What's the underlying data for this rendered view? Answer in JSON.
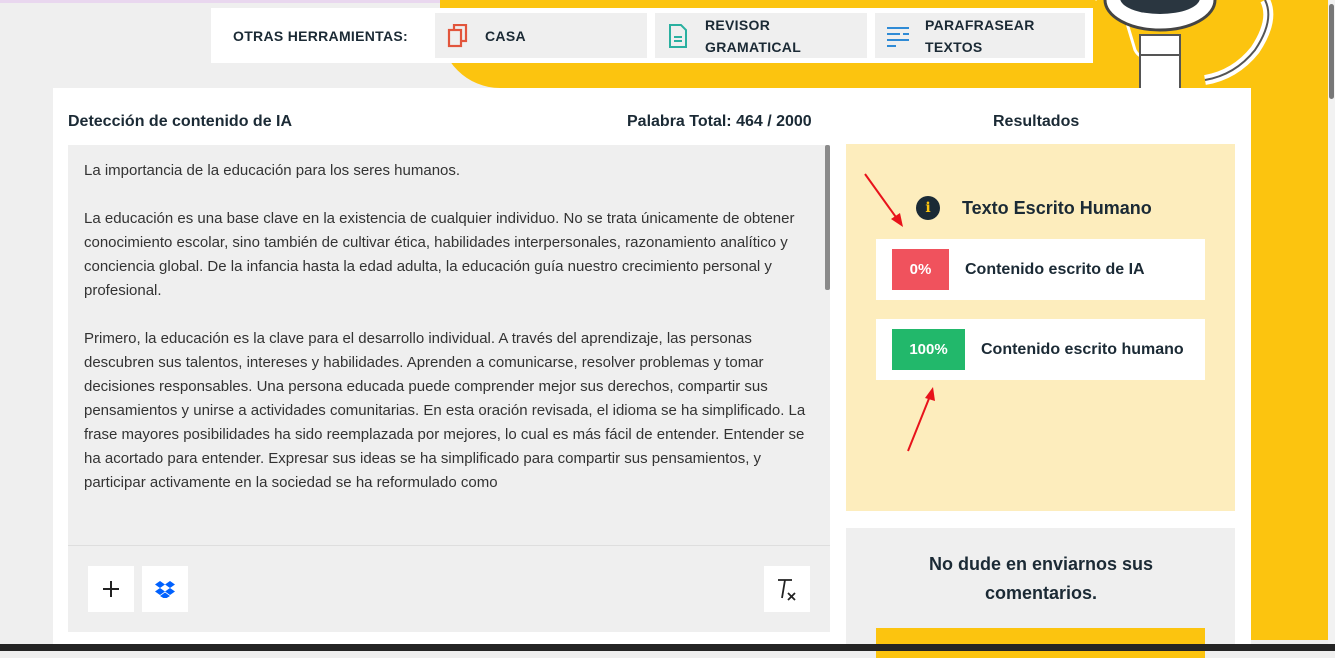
{
  "tools_bar": {
    "label": "OTRAS HERRAMIENTAS:",
    "items": [
      {
        "label": "CASA",
        "icon": "copy-icon",
        "color": "#e2553c"
      },
      {
        "label": "REVISOR GRAMATICAL",
        "icon": "document-icon",
        "color": "#2ab0a0"
      },
      {
        "label": "PARAFRASEAR TEXTOS",
        "icon": "paraphrase-icon",
        "color": "#2f8bd6"
      }
    ]
  },
  "detector": {
    "title": "Detección de contenido de IA",
    "word_count": "Palabra Total: 464 / 2000",
    "paragraphs": [
      "La importancia de la educación para los seres humanos.",
      "La educación es una base clave en la existencia de cualquier individuo. No se trata únicamente de obtener conocimiento escolar, sino también de cultivar ética, habilidades interpersonales, razonamiento analítico y conciencia global. De la infancia hasta la edad adulta, la educación guía nuestro crecimiento personal y profesional.",
      "Primero, la educación es la clave para el desarrollo individual. A través del aprendizaje, las personas descubren sus talentos, intereses y habilidades. Aprenden a comunicarse, resolver problemas y tomar decisiones responsables. Una persona educada puede comprender mejor sus derechos, compartir sus pensamientos y unirse a actividades comunitarias. En esta oración revisada, el idioma se ha simplificado. La frase mayores posibilidades ha sido reemplazada por mejores, lo cual es más fácil de entender. Entender se ha acortado para entender. Expresar sus ideas se ha simplificado para compartir sus pensamientos, y participar activamente en la sociedad se ha reformulado como"
    ]
  },
  "results": {
    "title": "Resultados",
    "verdict": "Texto Escrito Humano",
    "ai": {
      "value": "0%",
      "label": "Contenido escrito de IA",
      "color": "#f0525d"
    },
    "human": {
      "value": "100%",
      "label": "Contenido escrito humano",
      "color": "#22b86b"
    }
  },
  "feedback": {
    "text": "No dude en enviarnos sus comentarios."
  },
  "colors": {
    "accent": "#fcc40f",
    "annotation": "#e8131b"
  }
}
